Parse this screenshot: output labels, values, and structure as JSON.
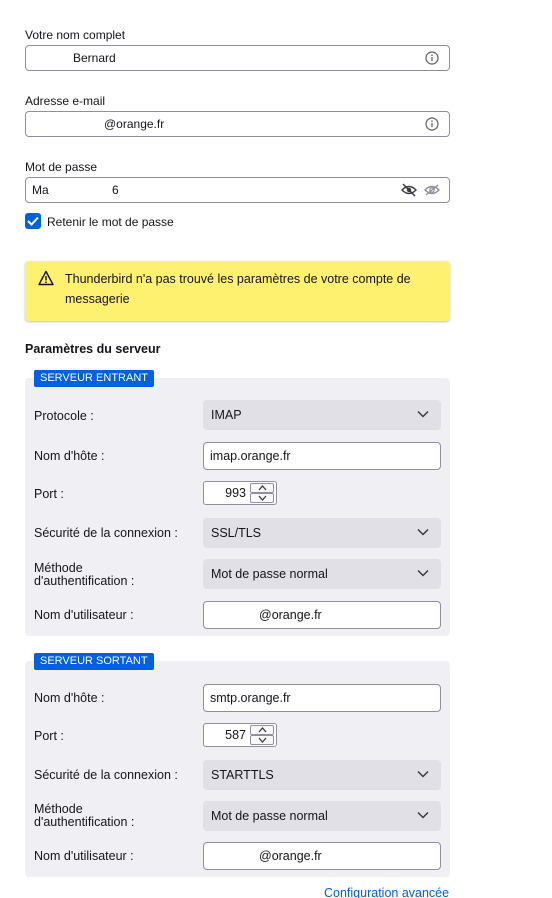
{
  "account": {
    "name_label": "Votre nom complet",
    "name_value": "Bernard",
    "email_label": "Adresse e-mail",
    "email_value": "@orange.fr",
    "password_label": "Mot de passe",
    "password_value": "Ma 6",
    "remember_label": "Retenir le mot de passe",
    "remember_checked": true
  },
  "warning": {
    "text": "Thunderbird n'a pas trouvé les paramètres de votre compte de messagerie"
  },
  "server_settings": {
    "title": "Paramètres du serveur",
    "incoming": {
      "badge": "SERVEUR ENTRANT",
      "protocol_label": "Protocole :",
      "protocol_value": "IMAP",
      "hostname_label": "Nom d'hôte :",
      "hostname_value": "imap.orange.fr",
      "port_label": "Port :",
      "port_value": "993",
      "security_label": "Sécurité de la connexion :",
      "security_value": "SSL/TLS",
      "auth_label_1": "Méthode",
      "auth_label_2": "d'authentification :",
      "auth_value": "Mot de passe normal",
      "username_label": "Nom d'utilisateur :",
      "username_value": "@orange.fr"
    },
    "outgoing": {
      "badge": "SERVEUR SORTANT",
      "hostname_label": "Nom d'hôte :",
      "hostname_value": "smtp.orange.fr",
      "port_label": "Port :",
      "port_value": "587",
      "security_label": "Sécurité de la connexion :",
      "security_value": "STARTTLS",
      "auth_label_1": "Méthode",
      "auth_label_2": "d'authentification :",
      "auth_value": "Mot de passe normal",
      "username_label": "Nom d'utilisateur :",
      "username_value": "@orange.fr"
    },
    "advanced_link": "Configuration avancée"
  },
  "colors": {
    "accent": "#0061e0",
    "warning_bg": "#fff170",
    "panel_bg": "#f0f0f4",
    "select_bg": "#e0e0e6"
  },
  "icons": [
    "info-icon",
    "eye-icon",
    "eye-slash-icon",
    "checkmark-icon",
    "warning-icon",
    "chevron-down-icon",
    "arrow-up-icon",
    "arrow-down-icon"
  ]
}
